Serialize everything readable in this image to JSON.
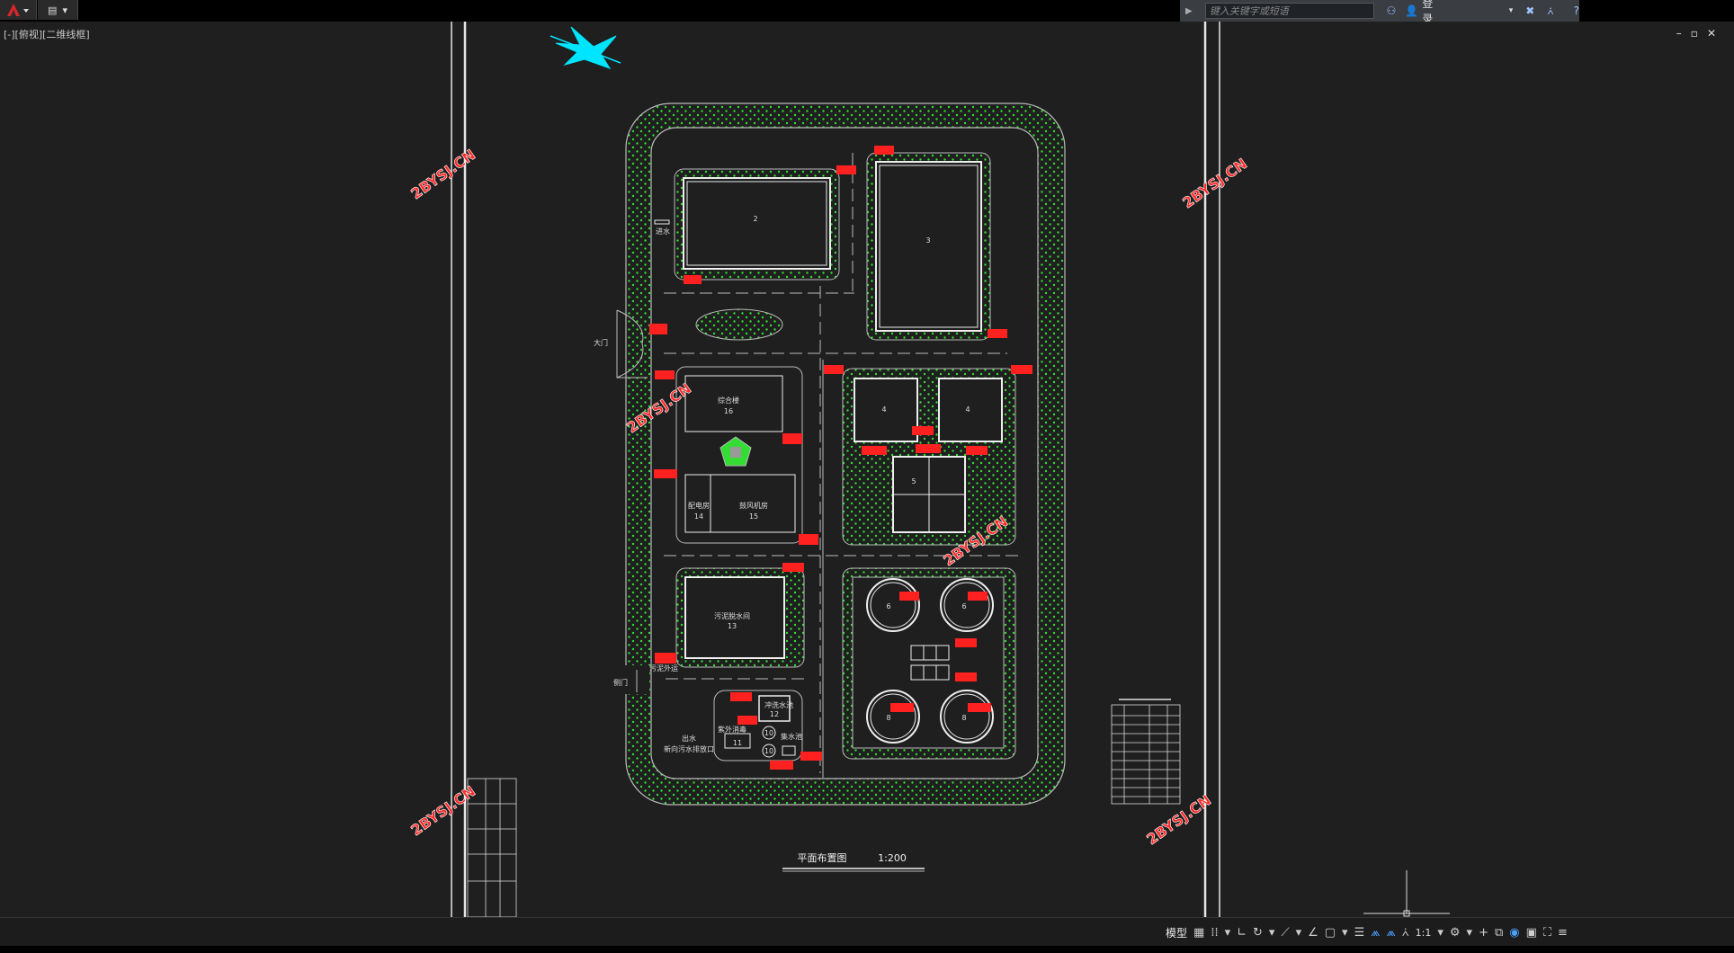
{
  "app": {
    "viewport_label": "[-][俯视][二维线框]",
    "search_placeholder": "键入关键字或短语",
    "login": "登录",
    "window_controls": [
      "–",
      "▫",
      "✕"
    ]
  },
  "drawing": {
    "watermark": "2BYSJ.CN",
    "title": "平面布置图",
    "scale": "1:200",
    "labels": {
      "gate_main": "大门",
      "gate_side": "侧门",
      "b2": "2",
      "b3": "3",
      "b4a": "4",
      "b4b": "4",
      "b5": "5",
      "b6a": "6",
      "b6b": "6",
      "b8a": "8",
      "b8b": "8",
      "office": "综合楼",
      "office_no": "16",
      "power": "配电房",
      "power_no": "14",
      "blower": "鼓风机房",
      "blower_no": "15",
      "sludge": "污泥脱水间",
      "sludge_no": "13",
      "sludge_out": "污泥外运",
      "wash_pool": "冲洗水池",
      "wash_no": "12",
      "disinfect": "紫外消毒",
      "disinfect_no": "11",
      "c10a": "10",
      "c10b": "10",
      "collect": "集水池",
      "outlet": "出水",
      "outlet2": "新向污水排放口",
      "inlet": "进水"
    }
  },
  "statusbar": {
    "model": "模型",
    "scale": "1:1"
  },
  "colors": {
    "green": "#33dd33",
    "red": "#ff2020",
    "cyan": "#00e5ff",
    "white": "#e6e6e6"
  }
}
